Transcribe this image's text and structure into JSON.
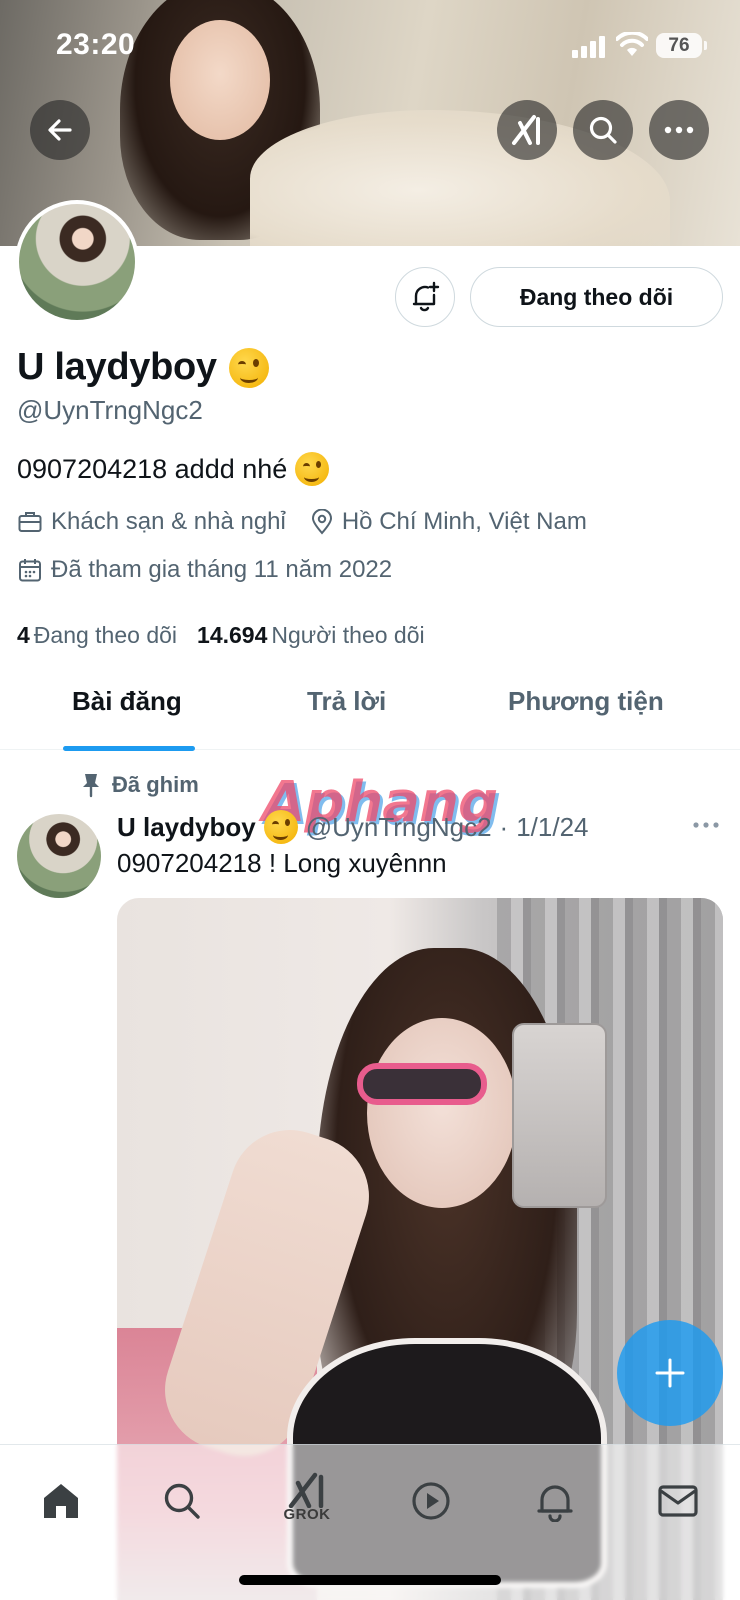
{
  "status_bar": {
    "time": "23:20",
    "battery": "76"
  },
  "header": {
    "back_icon": "arrow-left-icon",
    "grok_icon": "grok-icon",
    "search_icon": "search-icon",
    "more_icon": "more-horizontal-icon"
  },
  "profile": {
    "name": "U laydyboy",
    "handle": "@UynTrngNgc2",
    "bio": "0907204218 addd nhé",
    "category": "Khách sạn & nhà nghỉ",
    "location": "Hồ Chí Minh, Việt Nam",
    "joined": "Đã tham gia tháng 11 năm 2022",
    "following_count": "4",
    "following_label": "Đang theo dõi",
    "followers_count": "14.694",
    "followers_label": "Người theo dõi",
    "follow_button_label": "Đang theo dõi"
  },
  "tabs": [
    {
      "label": "Bài đăng",
      "active": true
    },
    {
      "label": "Trả lời",
      "active": false
    },
    {
      "label": "Phương tiện",
      "active": false
    }
  ],
  "pinned_post": {
    "pinned_label": "Đã ghim",
    "author_name": "U laydyboy",
    "author_handle": "@UynTrngNgc2",
    "date": "1/1/24",
    "text": "0907204218 ! Long xuyênnn"
  },
  "watermark": "Aphang",
  "bottom_nav": {
    "items": [
      "home-icon",
      "search-icon",
      "grok-icon",
      "video-play-icon",
      "notifications-bell-icon",
      "messages-envelope-icon"
    ],
    "grok_label": "GROK"
  },
  "colors": {
    "accent": "#1d9bf0",
    "text": "#0f1419",
    "secondary": "#536471",
    "border": "#cfd9de"
  }
}
